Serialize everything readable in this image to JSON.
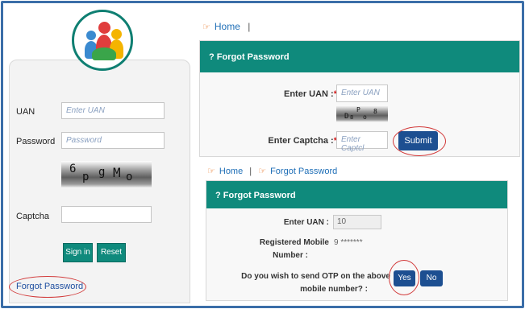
{
  "login": {
    "uan_label": "UAN",
    "uan_placeholder": "Enter UAN",
    "password_label": "Password",
    "password_placeholder": "Password",
    "captcha_chars": [
      "6",
      "p",
      "g",
      "M",
      "o"
    ],
    "captcha_label": "Captcha",
    "sign_in": "Sign in",
    "reset": "Reset",
    "forgot_password": "Forgot Password"
  },
  "top_breadcrumb": {
    "home": "Home",
    "separator": "|"
  },
  "forgot_panel": {
    "title": "Forgot Password",
    "enter_uan_label": "Enter UAN :",
    "enter_uan_placeholder": "Enter UAN",
    "captcha_chars": [
      "D",
      "8",
      "P",
      "o",
      "8"
    ],
    "enter_captcha_label": "Enter Captcha :",
    "enter_captcha_placeholder": "Enter Captcl",
    "submit": "Submit",
    "required_mark": "*"
  },
  "bottom_breadcrumb": {
    "home": "Home",
    "separator": "|",
    "current": "Forgot Password"
  },
  "otp_panel": {
    "title": "Forgot Password",
    "enter_uan_label": "Enter UAN :",
    "uan_value": "10",
    "registered_mobile_label_1": "Registered Mobile",
    "registered_mobile_label_2": "Number :",
    "mobile_value": "9 *******",
    "question_1": "Do you wish to send OTP on the above",
    "question_2": "mobile number? :",
    "yes": "Yes",
    "no": "No"
  },
  "colors": {
    "teal": "#0f8a7c",
    "blue_button": "#1d4f91",
    "link": "#1f6fb7",
    "annotation": "#d23a3a"
  }
}
